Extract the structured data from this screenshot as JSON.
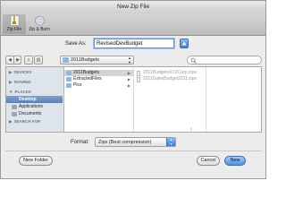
{
  "window": {
    "title": "New Zip File"
  },
  "toolbar": {
    "buttons": [
      {
        "label": "Zip File",
        "selected": true
      },
      {
        "label": "Zip & Burn",
        "selected": false
      }
    ]
  },
  "save_as": {
    "label": "Save As:",
    "value": "RevisedDevBudget"
  },
  "location": {
    "current_folder": "2011Budgets"
  },
  "sidebar": {
    "sections": [
      {
        "label": "DEVICES"
      },
      {
        "label": "SHARED"
      },
      {
        "label": "PLACES"
      },
      {
        "label": "SEARCH FOR"
      }
    ],
    "places_items": [
      {
        "label": "Desktop",
        "selected": true,
        "color": "#6b8fd6"
      },
      {
        "label": "Applications",
        "selected": false,
        "color": "#9aa6b8"
      },
      {
        "label": "Documents",
        "selected": false,
        "color": "#9aa6b8"
      }
    ]
  },
  "columns": {
    "first": [
      {
        "name": "2011Budgets",
        "selected": true
      },
      {
        "name": "ExtractedFiles",
        "selected": false
      },
      {
        "name": "Pics",
        "selected": false
      }
    ],
    "second": [
      {
        "name": "2011BudgetsXYZCorp.zipx"
      },
      {
        "name": "2011SalesBudget2011.zipx"
      }
    ]
  },
  "format": {
    "label": "Format:",
    "value": "Zipx (Best compression)"
  },
  "buttons": {
    "new_folder": "New Folder",
    "cancel": "Cancel",
    "new": "New"
  },
  "colors": {
    "accent": "#4e8fe6",
    "sidebar_bg": "#dde4ec",
    "window_bg": "#ececec"
  }
}
